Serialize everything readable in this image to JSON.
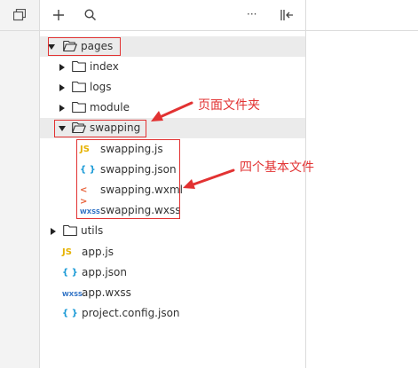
{
  "toolbar": {
    "icons": [
      "files-icon",
      "add-icon",
      "search-icon",
      "more-icon",
      "collapse-panel-icon"
    ],
    "more_label": "···"
  },
  "tree": {
    "pages": "pages",
    "index": "index",
    "logs": "logs",
    "module": "module",
    "swapping": "swapping",
    "swapping_files": [
      {
        "icon": "JS",
        "name": "swapping.js"
      },
      {
        "icon": "{ }",
        "name": "swapping.json"
      },
      {
        "icon": "< >",
        "name": "swapping.wxml"
      },
      {
        "icon": "WXSS",
        "name": "swapping.wxss"
      }
    ],
    "utils": "utils",
    "root_files": [
      {
        "icon": "JS",
        "name": "app.js"
      },
      {
        "icon": "{ }",
        "name": "app.json"
      },
      {
        "icon": "WXSS",
        "name": "app.wxss"
      },
      {
        "icon": "{ }",
        "name": "project.config.json"
      }
    ]
  },
  "annotations": {
    "page_folder": "页面文件夹",
    "four_files": "四个基本文件"
  },
  "colors": {
    "annotation": "#e23232",
    "selected_row": "#ebebeb",
    "js": "#e6b200",
    "json": "#1a9ad6",
    "wxml": "#e8623a",
    "wxss": "#2b6fc4"
  }
}
